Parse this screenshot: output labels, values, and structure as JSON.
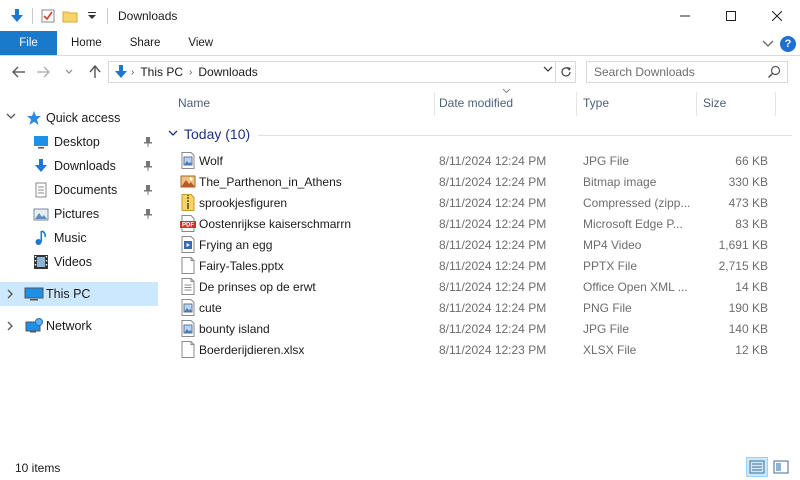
{
  "window": {
    "title": "Downloads"
  },
  "ribbon": {
    "tabs": [
      "File",
      "Home",
      "Share",
      "View"
    ]
  },
  "address": {
    "crumbs": [
      "This PC",
      "Downloads"
    ]
  },
  "search": {
    "placeholder": "Search Downloads"
  },
  "sidebar": {
    "items": [
      {
        "label": "Quick access",
        "icon": "star-icon",
        "level": 0,
        "expanded": true
      },
      {
        "label": "Desktop",
        "icon": "desktop-icon",
        "level": 1,
        "pinned": true
      },
      {
        "label": "Downloads",
        "icon": "downloads-icon",
        "level": 1,
        "pinned": true
      },
      {
        "label": "Documents",
        "icon": "documents-icon",
        "level": 1,
        "pinned": true
      },
      {
        "label": "Pictures",
        "icon": "pictures-icon",
        "level": 1,
        "pinned": true
      },
      {
        "label": "Music",
        "icon": "music-icon",
        "level": 1
      },
      {
        "label": "Videos",
        "icon": "videos-icon",
        "level": 1
      },
      {
        "label": "This PC",
        "icon": "computer-icon",
        "level": 0,
        "selected": true
      },
      {
        "label": "Network",
        "icon": "network-icon",
        "level": 0
      }
    ]
  },
  "columns": {
    "name": "Name",
    "date": "Date modified",
    "type": "Type",
    "size": "Size"
  },
  "group": {
    "label": "Today (10)"
  },
  "files": [
    {
      "name": "Wolf",
      "date": "8/11/2024 12:24 PM",
      "type": "JPG File",
      "size": "66 KB",
      "icon": "image-file-icon"
    },
    {
      "name": "The_Parthenon_in_Athens",
      "date": "8/11/2024 12:24 PM",
      "type": "Bitmap image",
      "size": "330 KB",
      "icon": "bitmap-file-icon"
    },
    {
      "name": "sprookjesfiguren",
      "date": "8/11/2024 12:24 PM",
      "type": "Compressed (zipp...",
      "size": "473 KB",
      "icon": "zip-folder-icon"
    },
    {
      "name": "Oostenrijkse kaiserschmarrn",
      "date": "8/11/2024 12:24 PM",
      "type": "Microsoft Edge P...",
      "size": "83 KB",
      "icon": "pdf-file-icon"
    },
    {
      "name": "Frying an egg",
      "date": "8/11/2024 12:24 PM",
      "type": "MP4 Video",
      "size": "1,691 KB",
      "icon": "video-file-icon"
    },
    {
      "name": "Fairy-Tales.pptx",
      "date": "8/11/2024 12:24 PM",
      "type": "PPTX File",
      "size": "2,715 KB",
      "icon": "blank-file-icon"
    },
    {
      "name": "De prinses op de erwt",
      "date": "8/11/2024 12:24 PM",
      "type": "Office Open XML ...",
      "size": "14 KB",
      "icon": "document-file-icon"
    },
    {
      "name": "cute",
      "date": "8/11/2024 12:24 PM",
      "type": "PNG File",
      "size": "190 KB",
      "icon": "image-file-icon"
    },
    {
      "name": "bounty island",
      "date": "8/11/2024 12:24 PM",
      "type": "JPG File",
      "size": "140 KB",
      "icon": "image-file-icon"
    },
    {
      "name": "Boerderijdieren.xlsx",
      "date": "8/11/2024 12:23 PM",
      "type": "XLSX File",
      "size": "12 KB",
      "icon": "blank-file-icon"
    }
  ],
  "status": {
    "count": "10 items"
  },
  "colors": {
    "accent": "#1979ca",
    "selection": "#cce8ff",
    "group_header": "#1e3287"
  }
}
